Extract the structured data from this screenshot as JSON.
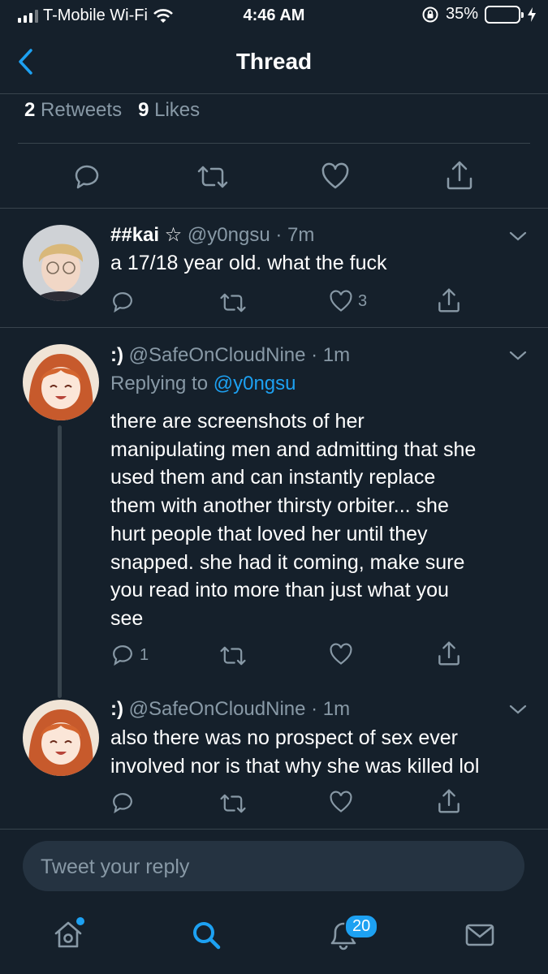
{
  "status_bar": {
    "carrier": "T-Mobile Wi-Fi",
    "time": "4:46 AM",
    "battery": "35%",
    "battery_level": 0.35
  },
  "nav": {
    "title": "Thread"
  },
  "stats": {
    "retweets_count": "2",
    "retweets_label": "Retweets",
    "likes_count": "9",
    "likes_label": "Likes"
  },
  "tweets": [
    {
      "name": "##kai ☆",
      "meta": "@y0ngsu · 7m",
      "text": "a 17/18 year old. what the fuck",
      "reply_count": "",
      "like_count": "3"
    },
    {
      "name": ":)",
      "meta": "@SafeOnCloudNine · 1m",
      "replying_prefix": "Replying to",
      "replying_handle": "@y0ngsu",
      "text_lines": [
        "there are screenshots of her",
        "manipulating men and admitting that she",
        "used them and can instantly replace",
        "them with another thirsty orbiter... she",
        "hurt people that loved her until they",
        "snapped. she had it coming, make sure",
        "you read into more than just what you",
        "see"
      ],
      "reply_count": "1",
      "like_count": ""
    },
    {
      "name": ":)",
      "meta": "@SafeOnCloudNine · 1m",
      "text_lines": [
        "also there was no prospect of sex ever",
        "involved nor is that why she was killed lol"
      ],
      "reply_count": "",
      "like_count": ""
    }
  ],
  "composer": {
    "placeholder": "Tweet your reply"
  },
  "tabbar": {
    "notifications_badge": "20"
  },
  "colors": {
    "background": "#15202b",
    "accent": "#1da1f2",
    "muted": "#8899a6",
    "battery": "#4cd964"
  }
}
